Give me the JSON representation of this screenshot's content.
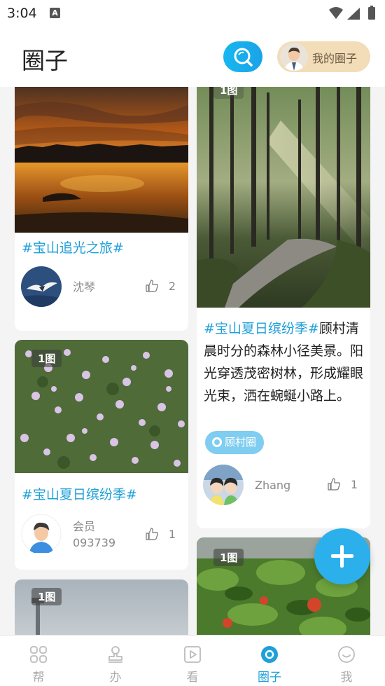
{
  "status_bar": {
    "time": "3:04",
    "notification_icon": "A"
  },
  "header": {
    "title": "圈子",
    "my_circle_label": "我的圈子"
  },
  "posts": [
    {
      "tag": "#宝山追光之旅#",
      "author": "沈琴",
      "likes": "2"
    },
    {
      "badge": "1图",
      "tag": "#宝山夏日缤纷季#",
      "desc": "顾村清晨时分的森林小径美景。阳光穿透茂密树林，形成耀眼光束，洒在蜿蜒小路上。",
      "chip": "顾村圈",
      "author": "Zhang",
      "likes": "1"
    },
    {
      "badge": "1图",
      "tag": "#宝山夏日缤纷季#",
      "author_line1": "会员",
      "author_line2": "093739",
      "likes": "1"
    },
    {
      "badge": "1图"
    },
    {
      "badge": "1图"
    }
  ],
  "tabs": [
    {
      "label": "帮",
      "icon": "grid-icon"
    },
    {
      "label": "办",
      "icon": "stamp-icon"
    },
    {
      "label": "看",
      "icon": "play-icon"
    },
    {
      "label": "圈子",
      "icon": "circle-icon",
      "active": true
    },
    {
      "label": "我",
      "icon": "smile-icon"
    }
  ],
  "colors": {
    "accent": "#1fa0d8",
    "fab": "#2cb0ec",
    "my_circle_bg": "#f3dcb8"
  }
}
